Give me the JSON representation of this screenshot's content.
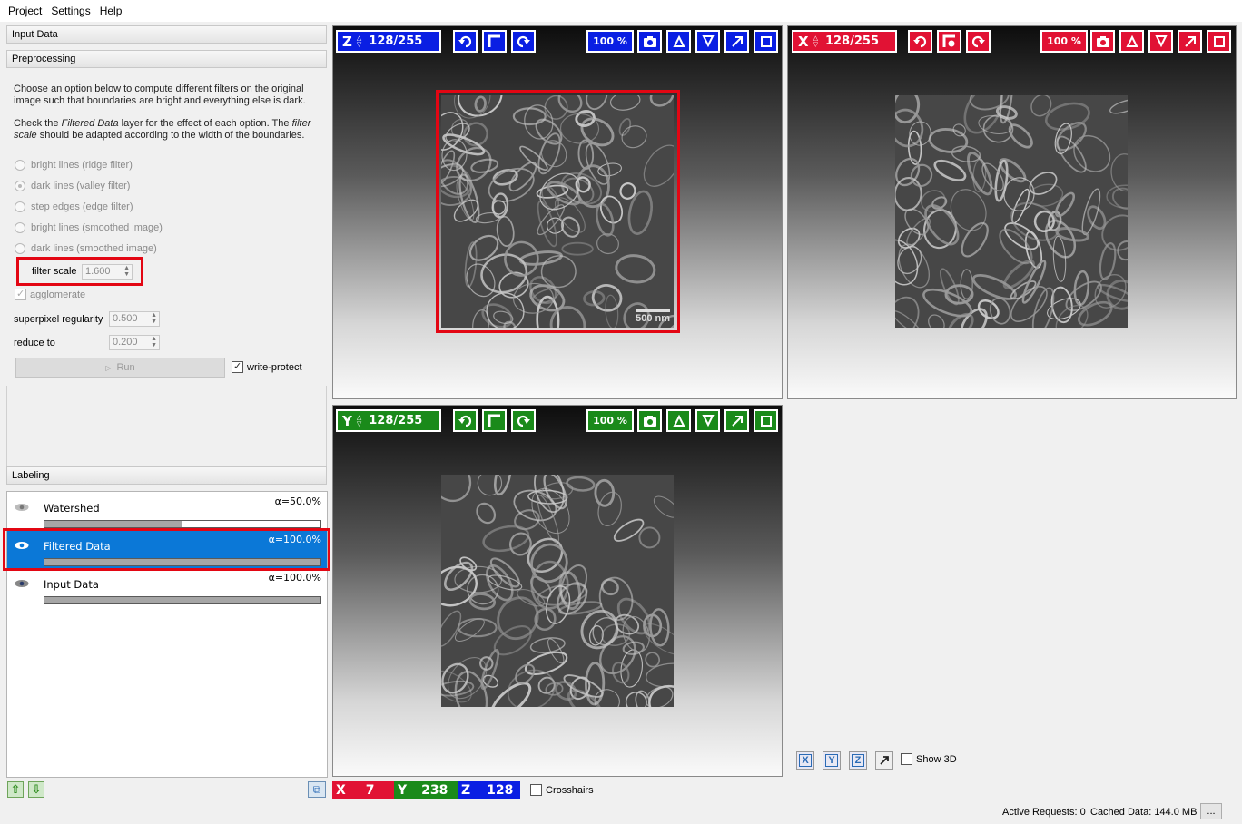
{
  "menu": [
    "Project",
    "Settings",
    "Help"
  ],
  "applets": {
    "input_data": "Input Data",
    "preprocessing": "Preprocessing",
    "labeling": "Labeling"
  },
  "preprocessing": {
    "desc1": "Choose an option below to compute different filters on the original image such that boundaries are bright and everything else is dark.",
    "desc2_parts": [
      "Check the ",
      "Filtered Data",
      " layer for the effect of each option. The ",
      "filter scale",
      " should be adapted according to the width of the boundaries."
    ],
    "options": [
      {
        "label": "bright lines (ridge filter)",
        "checked": false
      },
      {
        "label": "dark lines (valley filter)",
        "checked": true
      },
      {
        "label": "step edges (edge filter)",
        "checked": false
      },
      {
        "label": "bright lines (smoothed image)",
        "checked": false
      },
      {
        "label": "dark lines (smoothed image)",
        "checked": false
      }
    ],
    "filter_scale_label": "filter scale",
    "filter_scale_value": "1.600",
    "agglomerate_label": "agglomerate",
    "superpixel_label": "superpixel regularity",
    "superpixel_value": "0.500",
    "reduce_label": "reduce to",
    "reduce_value": "0.200",
    "run_label": "Run",
    "write_protect_label": "write-protect"
  },
  "layers": [
    {
      "name": "Watershed",
      "alpha": "α=50.0%",
      "opacity": 0.5
    },
    {
      "name": "Filtered Data",
      "alpha": "α=100.0%",
      "opacity": 1.0
    },
    {
      "name": "Input Data",
      "alpha": "α=100.0%",
      "opacity": 1.0
    }
  ],
  "views": {
    "z": {
      "axis": "Z",
      "slice": "128/255",
      "zoom": "100 %"
    },
    "x": {
      "axis": "X",
      "slice": "128/255",
      "zoom": "100 %"
    },
    "y": {
      "axis": "Y",
      "slice": "128/255",
      "zoom": "100 %"
    }
  },
  "scalebar": "500 nm",
  "coords": {
    "x_label": "X",
    "x": "7",
    "y_label": "Y",
    "y": "238",
    "z_label": "Z",
    "z": "128"
  },
  "crosshairs_label": "Crosshairs",
  "axis_buttons": [
    "X",
    "Y",
    "Z"
  ],
  "show3d_label": "Show 3D",
  "status": {
    "active": "Active Requests: 0",
    "cached": "Cached Data: 144.0 MB",
    "more": "..."
  },
  "colors": {
    "z_axis": "#0a1fe3",
    "x_axis": "#e11234",
    "y_axis": "#1a8a1a",
    "selection": "#0b78d7",
    "highlight": "#e30613"
  }
}
